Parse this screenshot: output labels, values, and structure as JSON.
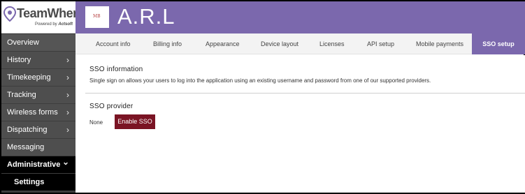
{
  "brand": {
    "name": "TeamWherx",
    "powered_by": "Powered by",
    "powered_by_company": "Actsoft"
  },
  "org": {
    "logo_text": "MB",
    "title": "A.R.L"
  },
  "sidebar": {
    "items": [
      {
        "label": "Overview",
        "chevron": ""
      },
      {
        "label": "History",
        "chevron": "›"
      },
      {
        "label": "Timekeeping",
        "chevron": "›"
      },
      {
        "label": "Tracking",
        "chevron": "›"
      },
      {
        "label": "Wireless forms",
        "chevron": "›"
      },
      {
        "label": "Dispatching",
        "chevron": "›"
      },
      {
        "label": "Messaging",
        "chevron": ""
      },
      {
        "label": "Administrative",
        "chevron": "⌄"
      },
      {
        "label": "Settings",
        "chevron": ""
      }
    ]
  },
  "tabs": [
    {
      "label": "Account info"
    },
    {
      "label": "Billing info"
    },
    {
      "label": "Appearance"
    },
    {
      "label": "Device layout"
    },
    {
      "label": "Licenses"
    },
    {
      "label": "API setup"
    },
    {
      "label": "Mobile payments"
    },
    {
      "label": "SSO setup",
      "active": true
    }
  ],
  "sso": {
    "info_title": "SSO information",
    "info_desc": "Single sign on allows your users to log into the application using an existing username and password from one of our supported providers.",
    "provider_title": "SSO provider",
    "provider_value": "None",
    "enable_label": "Enable SSO"
  },
  "colors": {
    "header_purple": "#7b68ad",
    "sidebar_dark": "#3d3d3d",
    "enable_button": "#7a1424"
  }
}
